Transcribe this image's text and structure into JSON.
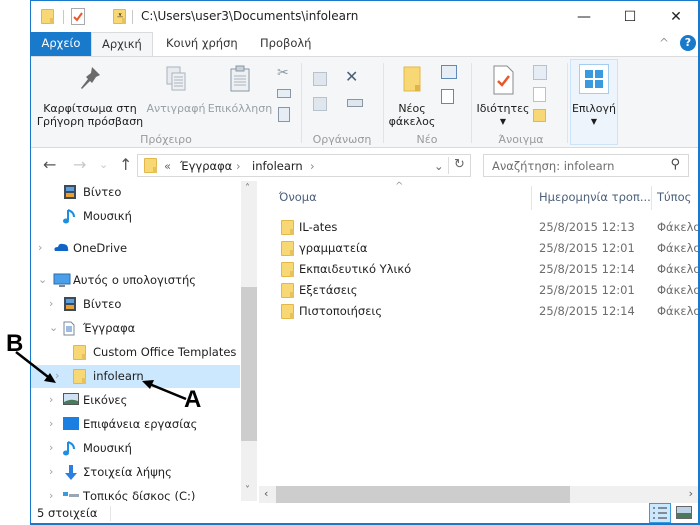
{
  "window": {
    "title": "C:\\Users\\user3\\Documents\\infolearn",
    "controls": {
      "minimize": "—",
      "maximize": "☐",
      "close": "✕"
    }
  },
  "quick_access": [
    {
      "icon": "folder-icon"
    },
    {
      "icon": "properties-check-icon"
    },
    {
      "icon": "new-folder-icon"
    },
    {
      "icon": "customize-dropdown-icon",
      "glyph": "⩡"
    }
  ],
  "ribbon": {
    "tabs": [
      {
        "label": "Αρχείο",
        "state": "file"
      },
      {
        "label": "Αρχική",
        "state": "active"
      },
      {
        "label": "Κοινή χρήση"
      },
      {
        "label": "Προβολή"
      }
    ],
    "collapse_glyph": "^",
    "help_glyph": "?",
    "groups": {
      "clipboard": {
        "label": "Πρόχειρο",
        "pin_label_1": "Καρφίτσωμα στη",
        "pin_label_2": "Γρήγορη πρόσβαση",
        "copy_label": "Αντιγραφή",
        "paste_label": "Επικόλληση"
      },
      "organize": {
        "label": "Οργάνωση"
      },
      "new": {
        "label": "Νέο",
        "new_folder_1": "Νέος",
        "new_folder_2": "φάκελος"
      },
      "open": {
        "label": "Άνοιγμα",
        "properties_label": "Ιδιότητες"
      },
      "select": {
        "label": "Επιλογή"
      }
    }
  },
  "address_bar": {
    "overflow": "«",
    "crumbs": [
      "Έγγραφα",
      "infolearn"
    ],
    "separator": "›",
    "search_placeholder": "Αναζήτηση: infolearn"
  },
  "nav_glyphs": {
    "back": "←",
    "forward": "→",
    "recent": "⌄",
    "up": "↑",
    "refresh": "↻",
    "dropdown": "⌄",
    "search": "⚲"
  },
  "nav_pane": {
    "items": [
      {
        "label": "Βίντεο",
        "icon": "video-icon",
        "indent": 1,
        "chevron": ""
      },
      {
        "label": "Μουσική",
        "icon": "music-icon",
        "indent": 1,
        "chevron": ""
      },
      {
        "label": "OneDrive",
        "icon": "onedrive-icon",
        "indent": 0,
        "chevron": "›"
      },
      {
        "label": "Αυτός ο υπολογιστής",
        "icon": "computer-icon",
        "indent": 0,
        "chevron": "⌄"
      },
      {
        "label": "Βίντεο",
        "icon": "video-icon",
        "indent": 1,
        "chevron": "›"
      },
      {
        "label": "Έγγραφα",
        "icon": "documents-icon",
        "indent": 1,
        "chevron": "⌄"
      },
      {
        "label": "Custom Office Templates",
        "icon": "folder-icon",
        "indent": 2,
        "chevron": ""
      },
      {
        "label": "infolearn",
        "icon": "folder-icon",
        "indent": 2,
        "chevron": "›",
        "selected": true
      },
      {
        "label": "Εικόνες",
        "icon": "pictures-icon",
        "indent": 1,
        "chevron": "›"
      },
      {
        "label": "Επιφάνεια εργασίας",
        "icon": "desktop-icon",
        "indent": 1,
        "chevron": "›"
      },
      {
        "label": "Μουσική",
        "icon": "music-icon",
        "indent": 1,
        "chevron": "›"
      },
      {
        "label": "Στοιχεία λήψης",
        "icon": "downloads-icon",
        "indent": 1,
        "chevron": "›"
      },
      {
        "label": "Τοπικός δίσκος (C:)",
        "icon": "drive-icon",
        "indent": 1,
        "chevron": "›"
      }
    ]
  },
  "file_list": {
    "columns": [
      "Όνομα",
      "Ημερομηνία τροπ...",
      "Τύπος"
    ],
    "sort_glyph": "^",
    "rows": [
      {
        "name": "IL-ates",
        "date": "25/8/2015 12:13",
        "type": "Φάκελο"
      },
      {
        "name": "γραμματεία",
        "date": "25/8/2015 12:01",
        "type": "Φάκελο"
      },
      {
        "name": "Εκπαιδευτικό Υλικό",
        "date": "25/8/2015 12:14",
        "type": "Φάκελο"
      },
      {
        "name": "Εξετάσεις",
        "date": "25/8/2015 12:01",
        "type": "Φάκελο"
      },
      {
        "name": "Πιστοποιήσεις",
        "date": "25/8/2015 12:14",
        "type": "Φάκελο"
      }
    ]
  },
  "status_bar": {
    "count": "5 στοιχεία"
  },
  "annotations": {
    "a": "A",
    "b": "B"
  },
  "colors": {
    "accent": "#1979ca",
    "selection": "#cce8ff",
    "folder": "#f8d775"
  }
}
